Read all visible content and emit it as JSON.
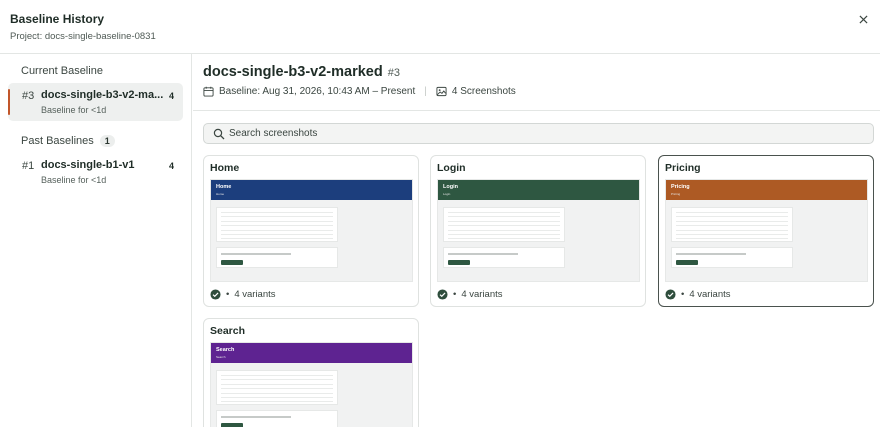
{
  "header": {
    "title": "Baseline History",
    "project": "Project: docs-single-baseline-0831"
  },
  "sidebar": {
    "current_label": "Current Baseline",
    "current": {
      "num": "#3",
      "name": "docs-single-b3-v2-ma...",
      "count": "4",
      "sub": "Baseline for <1d"
    },
    "past_label": "Past Baselines",
    "past_count": "1",
    "past": [
      {
        "num": "#1",
        "name": "docs-single-b1-v1",
        "count": "4",
        "sub": "Baseline for <1d"
      }
    ]
  },
  "main": {
    "title": "docs-single-b3-v2-marked",
    "title_num": "#3",
    "baseline_dates": "Baseline: Aug 31, 2026, 10:43 AM – Present",
    "screenshots": "4 Screenshots",
    "search_placeholder": "Search screenshots"
  },
  "cards": [
    {
      "name": "Home",
      "variants": "4 variants",
      "band_color": "#1c3e7d",
      "thumb_title": "Home",
      "thumb_sub": "Home"
    },
    {
      "name": "Login",
      "variants": "4 variants",
      "band_color": "#2e5741",
      "thumb_title": "Login",
      "thumb_sub": "Login"
    },
    {
      "name": "Pricing",
      "variants": "4 variants",
      "band_color": "#ad5a24",
      "thumb_title": "Pricing",
      "thumb_sub": "Pricing"
    },
    {
      "name": "Search",
      "variants": "",
      "band_color": "#5e2391",
      "thumb_title": "Search",
      "thumb_sub": "Search"
    }
  ],
  "colors": {
    "accent": "#c2562a",
    "check": "#2e4d3c"
  },
  "icons": {
    "close": "close-icon",
    "calendar": "calendar-icon",
    "image": "image-icon",
    "search": "search-icon",
    "check": "check-circle-icon"
  }
}
